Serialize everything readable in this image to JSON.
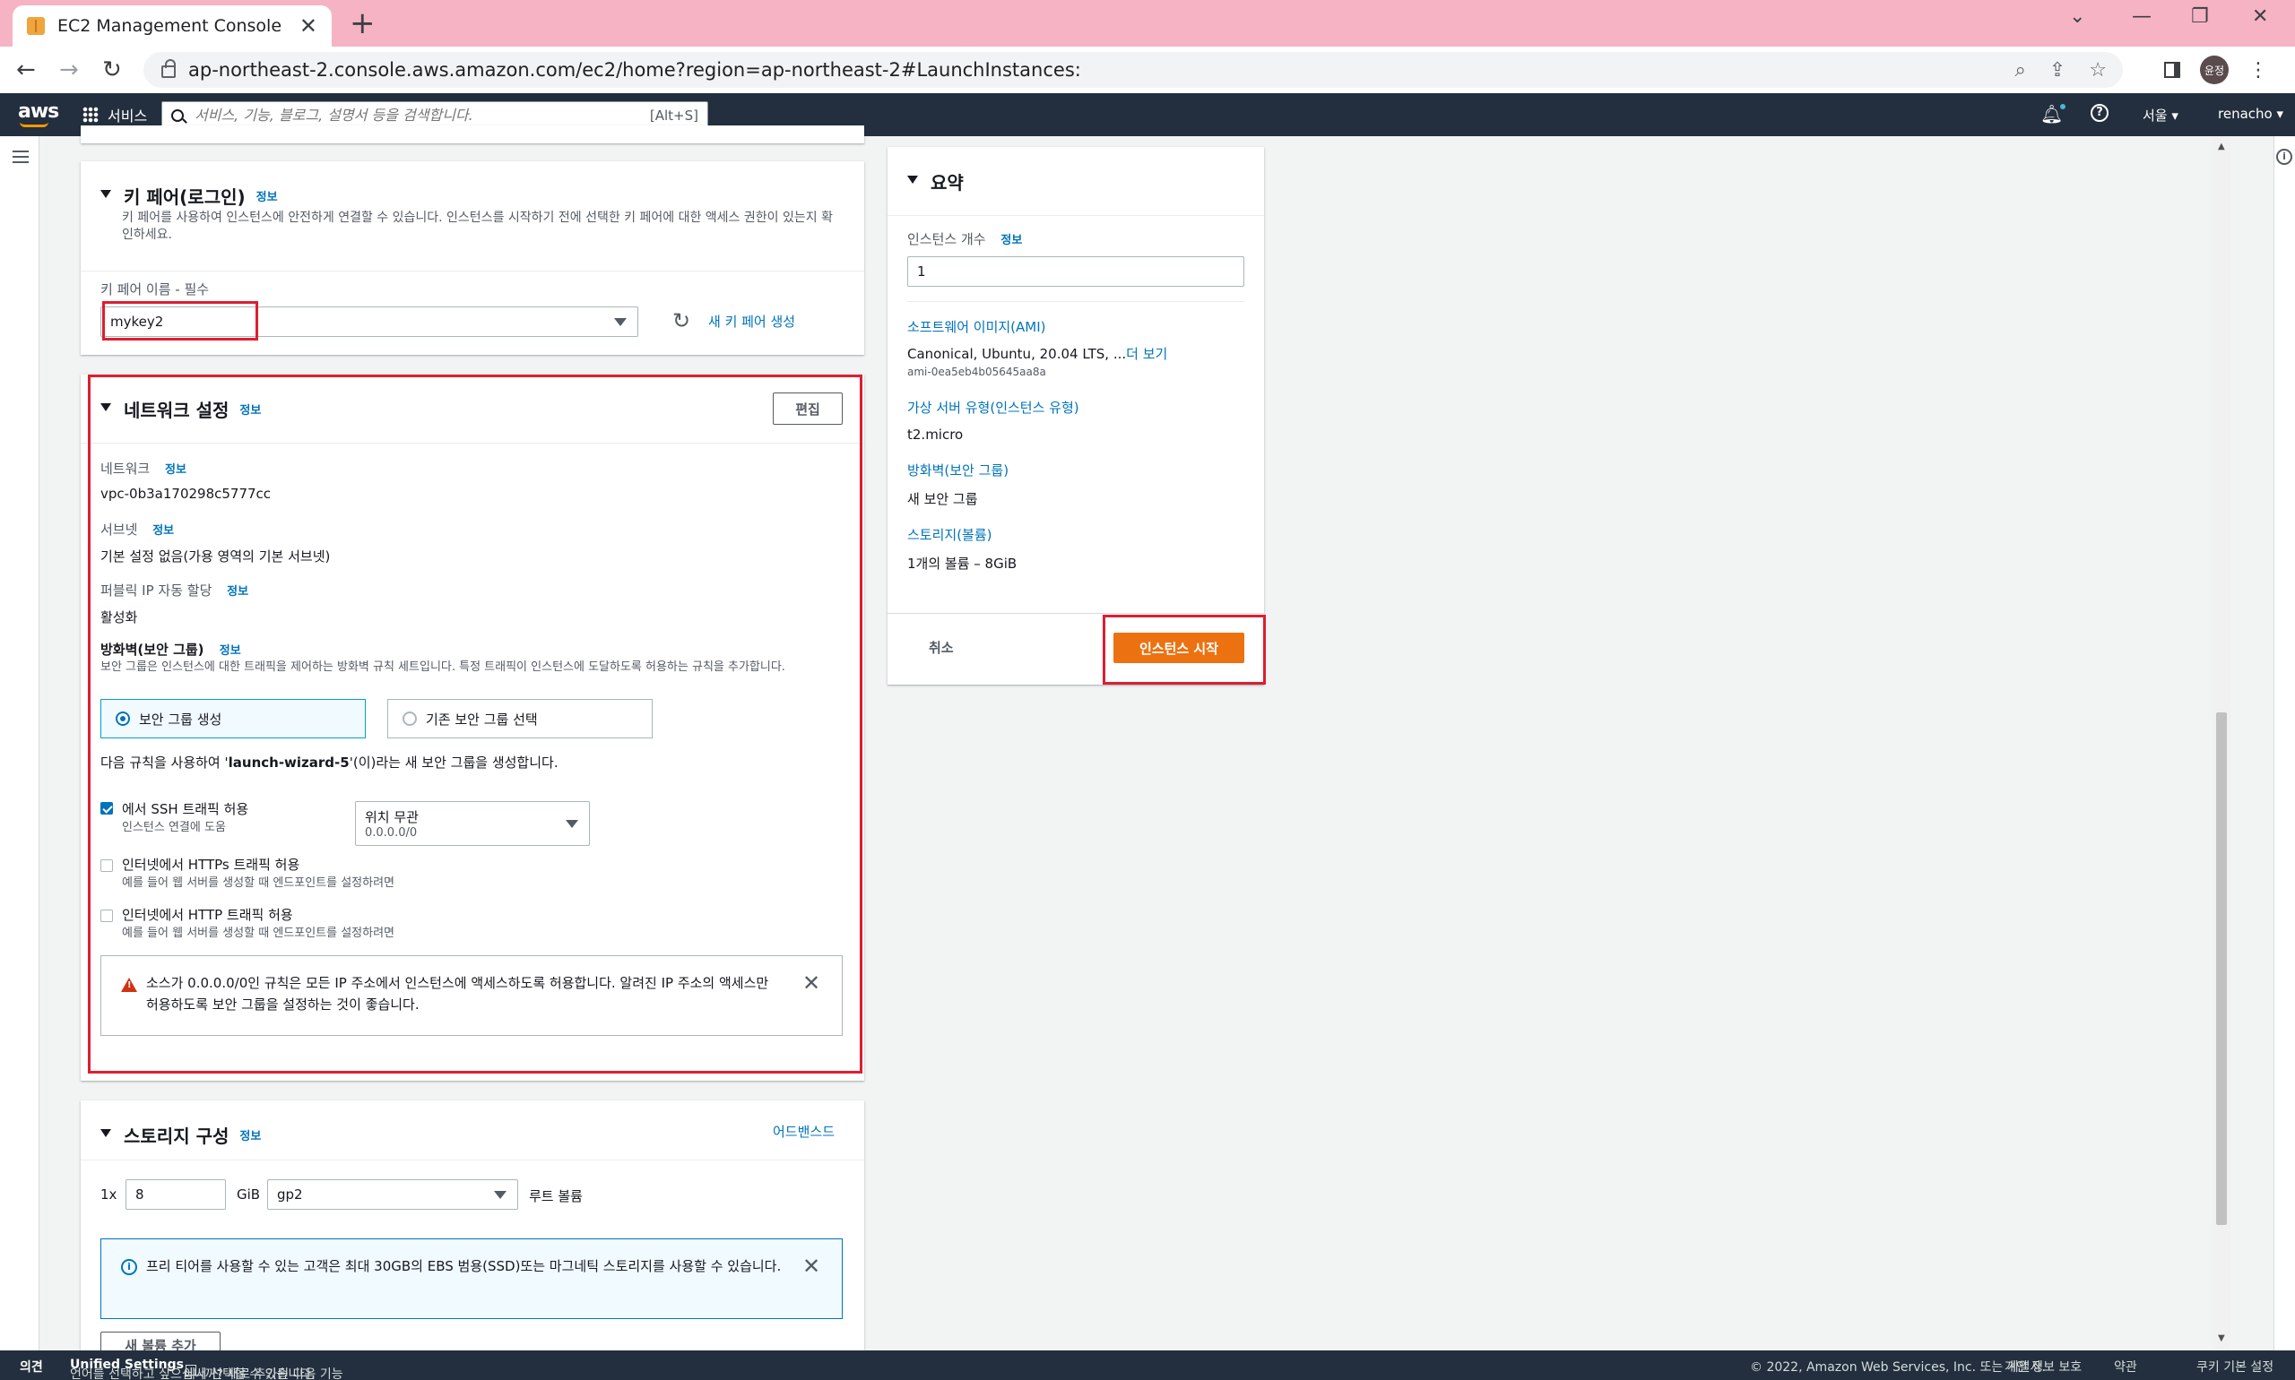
{
  "browser": {
    "tab_title": "EC2 Management Console",
    "url": "ap-northeast-2.console.aws.amazon.com/ec2/home?region=ap-northeast-2#LaunchInstances:",
    "profile_initials": "윤정"
  },
  "aws_nav": {
    "logo": "aws",
    "services_label": "서비스",
    "search_placeholder": "서비스, 기능, 블로그, 설명서 등을 검색합니다.",
    "search_shortcut": "[Alt+S]",
    "region_label": "서울 ▾",
    "account_label": "renacho ▾"
  },
  "key_pair": {
    "title": "키 페어(로그인)",
    "info": "정보",
    "description": "키 페어를 사용하여 인스턴스에 안전하게 연결할 수 있습니다. 인스턴스를 시작하기 전에 선택한 키 페어에 대한 액세스 권한이 있는지 확인하세요.",
    "name_label": "키 페어 이름 - 필수",
    "selected_value": "mykey2",
    "create_new_link": "새 키 페어 생성"
  },
  "network": {
    "title": "네트워크 설정",
    "info": "정보",
    "edit_button": "편집",
    "network_label": "네트워크",
    "network_value": "vpc-0b3a170298c5777cc",
    "subnet_label": "서브넷",
    "subnet_value": "기본 설정 없음(가용 영역의 기본 서브넷)",
    "public_ip_label": "퍼블릭 IP 자동 할당",
    "public_ip_value": "활성화",
    "firewall_label": "방화벽(보안 그룹)",
    "firewall_description": "보안 그룹은 인스턴스에 대한 트래픽을 제어하는 방화벽 규칙 세트입니다. 특정 트래픽이 인스턴스에 도달하도록 허용하는 규칙을 추가합니다.",
    "radio_create": "보안 그룹 생성",
    "radio_existing": "기존 보안 그룹 선택",
    "rule_text_prefix": "다음 규칙을 사용하여 '",
    "rule_group_name": "launch-wizard-5",
    "rule_text_suffix": "'(이)라는 새 보안 그룹을 생성합니다.",
    "ssh_label": "에서 SSH 트래픽 허용",
    "ssh_sub": "인스턴스 연결에 도움",
    "ssh_source_label": "위치 무관",
    "ssh_source_value": "0.0.0.0/0",
    "https_label": "인터넷에서 HTTPs 트래픽 허용",
    "https_sub": "예를 들어 웹 서버를 생성할 때 엔드포인트를 설정하려면",
    "http_label": "인터넷에서 HTTP 트래픽 허용",
    "http_sub": "예를 들어 웹 서버를 생성할 때 엔드포인트를 설정하려면",
    "warning_text": "소스가 0.0.0.0/0인 규칙은 모든 IP 주소에서 인스턴스에 액세스하도록 허용합니다. 알려진 IP 주소의 액세스만 허용하도록 보안 그룹을 설정하는 것이 좋습니다."
  },
  "storage": {
    "title": "스토리지 구성",
    "info": "정보",
    "advanced_link": "어드밴스드",
    "count_prefix": "1x",
    "size_value": "8",
    "unit": "GiB",
    "volume_type": "gp2",
    "root_label": "루트 볼륨",
    "free_tier_text": "프리 티어를 사용할 수 있는 고객은 최대 30GB의 EBS 범용(SSD)또는 마그네틱 스토리지를 사용할 수 있습니다.",
    "add_volume_button": "새 볼륨 추가"
  },
  "summary": {
    "title": "요약",
    "instance_count_label": "인스턴스 개수",
    "instance_count_info": "정보",
    "instance_count_value": "1",
    "ami_link": "소프트웨어 이미지(AMI)",
    "ami_value": "Canonical, Ubuntu, 20.04 LTS, ...",
    "ami_more": "더 보기",
    "ami_id": "ami-0ea5eb4b05645aa8a",
    "instance_type_link": "가상 서버 유형(인스턴스 유형)",
    "instance_type_value": "t2.micro",
    "firewall_link": "방화벽(보안 그룹)",
    "firewall_value": "새 보안 그룹",
    "storage_link": "스토리지(볼륨)",
    "storage_value": "1개의 볼륨 – 8GiB",
    "cancel_button": "취소",
    "launch_button": "인스턴스 시작"
  },
  "footer": {
    "feedback": "의견",
    "language_prefix": "언어를 선택하고 싶으십니까? 새로 추가된 다음 기능",
    "language_bold": "Unified Settings",
    "language_suffix": "에서 선택할 수 있습니다.",
    "copyright": "© 2022, Amazon Web Services, Inc. 또는 계열사.",
    "privacy": "개인 정보 보호",
    "terms": "약관",
    "cookies": "쿠키 기본 설정"
  },
  "colors": {
    "aws_nav": "#232f3e",
    "primary_button": "#ec7211",
    "link": "#0073bb",
    "highlight_box": "#dd1e31",
    "tab_bar": "#f6b3c4"
  }
}
